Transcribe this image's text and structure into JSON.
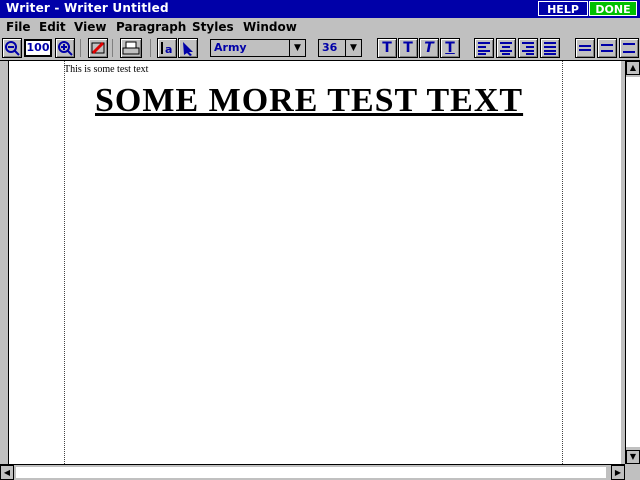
{
  "window": {
    "title": "Writer - Writer Untitled",
    "help_label": "HELP",
    "done_label": "DONE"
  },
  "menu": [
    "File",
    "Edit",
    "View",
    "Paragraph",
    "Styles",
    "Window"
  ],
  "toolbar": {
    "zoom_value": "100",
    "font_name": "Army",
    "font_size": "36",
    "style_buttons": [
      "T",
      "T",
      "T",
      "T"
    ]
  },
  "document": {
    "line1": "This is some test text",
    "line2": "SOME MORE TEST TEXT"
  }
}
